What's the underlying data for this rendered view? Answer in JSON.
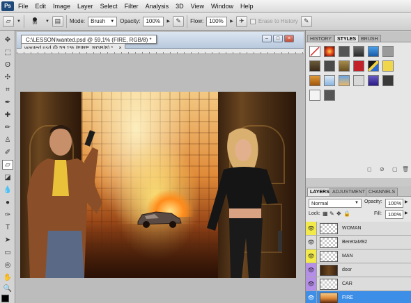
{
  "menubar": {
    "app_logo": "Ps",
    "items": [
      "File",
      "Edit",
      "Image",
      "Layer",
      "Select",
      "Filter",
      "Analysis",
      "3D",
      "View",
      "Window",
      "Help"
    ]
  },
  "options": {
    "brush_size": "90",
    "mode_label": "Mode:",
    "mode_value": "Brush",
    "opacity_label": "Opacity:",
    "opacity_value": "100%",
    "flow_label": "Flow:",
    "flow_value": "100%",
    "erase_to_history": "Erase to History"
  },
  "document": {
    "title": "C:\\LESSON\\wanted.psd @ 59,1% (FIRE, RGB/8) *",
    "tab": "wanted.psd @ 59,1% (FIRE, RGB/8) *",
    "close_x": "×"
  },
  "panels": {
    "top_tabs": [
      "HISTORY",
      "STYLES",
      "BRUSH"
    ],
    "active_top_tab": "STYLES",
    "layer_tabs": [
      "LAYERS",
      "ADJUSTMENT",
      "CHANNELS"
    ],
    "active_layer_tab": "LAYERS"
  },
  "layers": {
    "blend_mode": "Normal",
    "opacity_label": "Opacity:",
    "opacity_value": "100%",
    "lock_label": "Lock:",
    "fill_label": "Fill:",
    "fill_value": "100%",
    "items": [
      {
        "name": "WOMAN",
        "eye_color": "#f2ea4a"
      },
      {
        "name": "BerettaM92",
        "eye_color": "#dcdcdc"
      },
      {
        "name": "MAN",
        "eye_color": "#f2ea4a"
      },
      {
        "name": "door",
        "eye_color": "#b58ee8"
      },
      {
        "name": "CAR",
        "eye_color": "#b58ee8"
      },
      {
        "name": "FIRE",
        "eye_color": "#3d8ee6"
      }
    ],
    "selected": "FIRE"
  },
  "colors": {
    "selection": "#3d8ee6",
    "window_title": "#b9c9dd"
  }
}
